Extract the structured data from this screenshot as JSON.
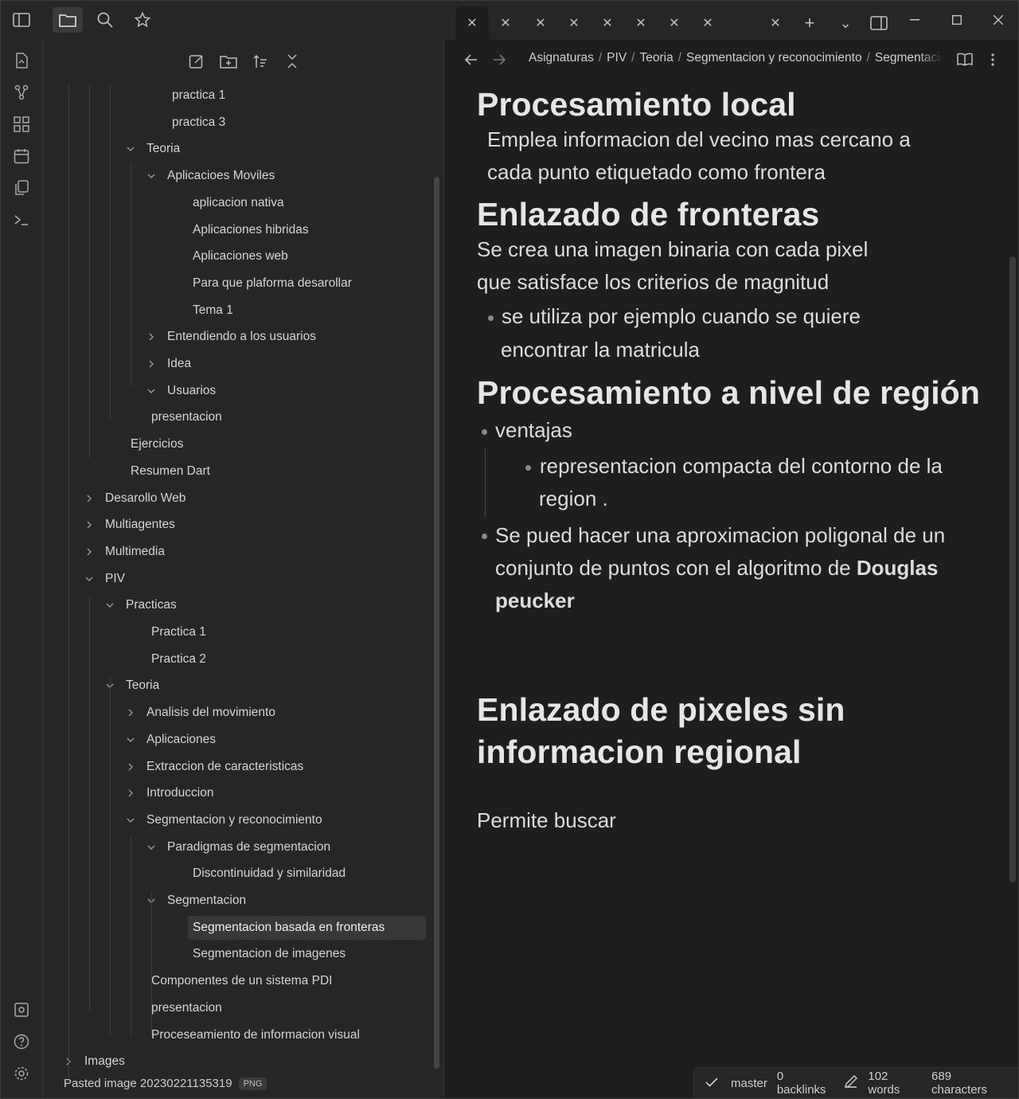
{
  "tabs": {
    "count_visible": 9,
    "new_tab_symbol": "+",
    "list_symbol": "⌄"
  },
  "sidebar": {
    "tree": [
      {
        "label": "practica 1",
        "expanded": null
      },
      {
        "label": "practica 3",
        "expanded": null
      },
      {
        "label": "Teoria",
        "expanded": true
      },
      {
        "label": "Aplicacioes Moviles",
        "expanded": true
      },
      {
        "label": "aplicacion nativa",
        "expanded": null
      },
      {
        "label": "Aplicaciones hibridas",
        "expanded": null
      },
      {
        "label": "Aplicaciones web",
        "expanded": null
      },
      {
        "label": "Para que plaforma desarollar",
        "expanded": null
      },
      {
        "label": "Tema 1",
        "expanded": null
      },
      {
        "label": "Entendiendo a los usuarios",
        "expanded": false
      },
      {
        "label": "Idea",
        "expanded": false
      },
      {
        "label": "Usuarios",
        "expanded": true
      },
      {
        "label": "presentacion",
        "expanded": null
      },
      {
        "label": "Ejercicios",
        "expanded": null
      },
      {
        "label": "Resumen Dart",
        "expanded": null
      },
      {
        "label": "Desarollo Web",
        "expanded": false
      },
      {
        "label": "Multiagentes",
        "expanded": false
      },
      {
        "label": "Multimedia",
        "expanded": false
      },
      {
        "label": "PIV",
        "expanded": true
      },
      {
        "label": "Practicas",
        "expanded": true
      },
      {
        "label": "Practica 1",
        "expanded": null
      },
      {
        "label": "Practica 2",
        "expanded": null
      },
      {
        "label": "Teoria",
        "expanded": true
      },
      {
        "label": "Analisis del movimiento",
        "expanded": false
      },
      {
        "label": "Aplicaciones",
        "expanded": true
      },
      {
        "label": "Extraccion de caracteristicas",
        "expanded": false
      },
      {
        "label": "Introduccion",
        "expanded": false
      },
      {
        "label": "Segmentacion y reconocimiento",
        "expanded": true
      },
      {
        "label": "Paradigmas de segmentacion",
        "expanded": true
      },
      {
        "label": "Discontinuidad y similaridad",
        "expanded": null
      },
      {
        "label": "Segmentacion",
        "expanded": true
      },
      {
        "label": "Segmentacion basada en fronteras",
        "expanded": null,
        "selected": true
      },
      {
        "label": "Segmentacion de imagenes",
        "expanded": null
      },
      {
        "label": "Componentes de un sistema PDI",
        "expanded": null
      },
      {
        "label": "presentacion",
        "expanded": null
      },
      {
        "label": "Proceseamiento de informacion visual",
        "expanded": null
      },
      {
        "label": "Images",
        "expanded": false
      }
    ],
    "footer_file": "Pasted image 20230221135319",
    "footer_badge": "PNG"
  },
  "breadcrumb": {
    "items": [
      "Asignaturas",
      "PIV",
      "Teoria",
      "Segmentacion y reconocimiento",
      "Segmentacion basada en fronteras"
    ]
  },
  "note": {
    "h_local": "Procesamiento local",
    "p_local_1": "Emplea informacion del vecino mas cercano a",
    "p_local_2": "cada punto etiquetado como frontera",
    "h_enlazado": "Enlazado de fronteras",
    "p_enl_1": "Se crea una imagen binaria con cada pixel",
    "p_enl_2": "que satisface los criterios de magnitud",
    "b_enl_1": "se utiliza por ejemplo cuando se quiere",
    "b_enl_2": "encontrar la matricula",
    "h_region": "Procesamiento a nivel de región",
    "b_ventajas": "ventajas",
    "b_rep_1": "representacion compacta del contorno de la",
    "b_rep_2": "region .",
    "b_pol_1": "Se pued hacer una aproximacion poligonal de un",
    "b_pol_2a": "conjunto de puntos con el algoritmo de ",
    "b_pol_2b": "Douglas",
    "b_pol_3": "peucker",
    "h_pixeles_1": "Enlazado de pixeles sin",
    "h_pixeles_2": "informacion regional",
    "p_permite": "Permite buscar"
  },
  "status": {
    "branch": "master",
    "backlinks": "0 backlinks",
    "words": "102 words",
    "characters": "689 characters"
  }
}
